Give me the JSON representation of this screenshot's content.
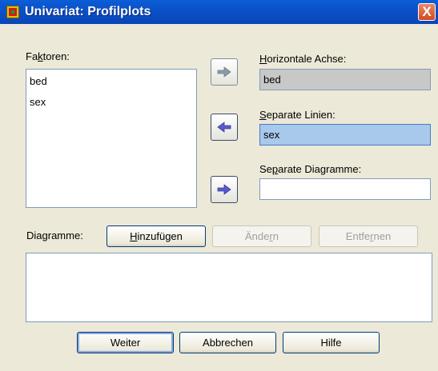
{
  "window": {
    "title": "Univariat: Profilplots",
    "close_label": "X"
  },
  "factors": {
    "label_pre": "Fa",
    "label_mnemonic": "k",
    "label_post": "toren:",
    "items": [
      "bed",
      "sex"
    ]
  },
  "horizontal_axis": {
    "label_mnemonic": "H",
    "label_post": "orizontale Achse:",
    "value": "bed"
  },
  "separate_lines": {
    "label_mnemonic": "S",
    "label_post": "eparate Linien:",
    "value": "sex"
  },
  "separate_diagrams": {
    "label_pre": "Se",
    "label_mnemonic": "p",
    "label_post": "arate Diagramme:",
    "value": ""
  },
  "diagrams": {
    "label_pre": "Dia",
    "label_mnemonic": "g",
    "label_post": "ramme:",
    "add_pre": "",
    "add_mnemonic": "H",
    "add_post": "inzufügen",
    "change_pre": "Ände",
    "change_mnemonic": "r",
    "change_post": "n",
    "remove_pre": "Entfe",
    "remove_mnemonic": "r",
    "remove_post": "nen"
  },
  "buttons": {
    "continue": "Weiter",
    "cancel": "Abbrechen",
    "help": "Hilfe"
  },
  "colors": {
    "arrow_enabled": "#5a5ac8",
    "arrow_disabled": "#8a9aa8"
  }
}
